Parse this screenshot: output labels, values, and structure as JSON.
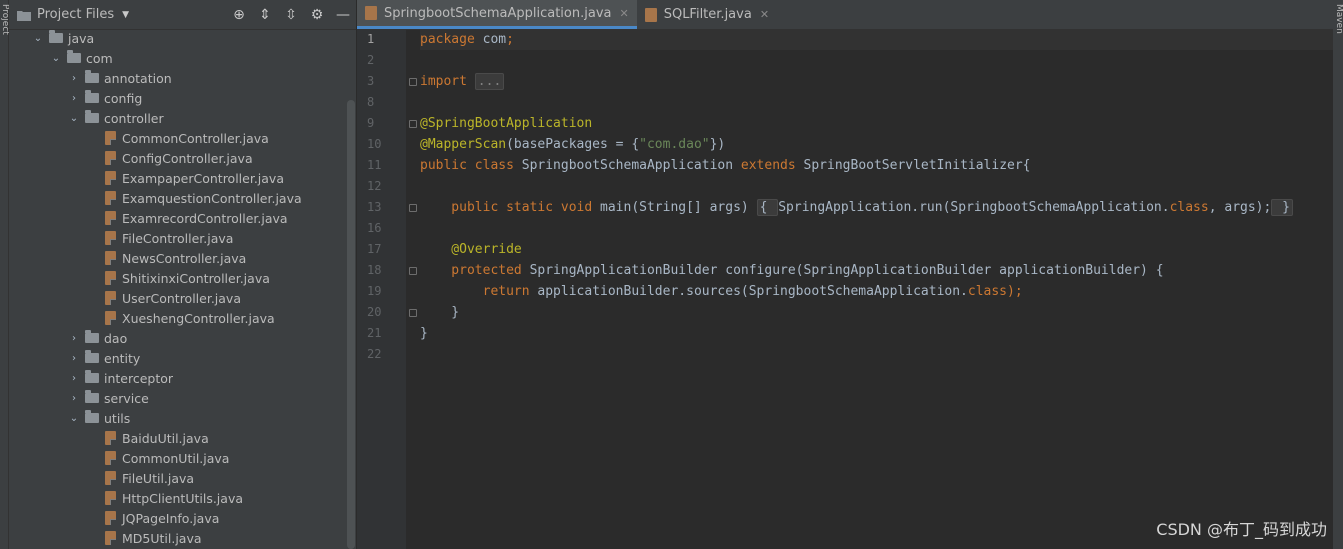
{
  "left_strip": {
    "label": "Project"
  },
  "right_strip": {
    "label": "Maven"
  },
  "project_panel": {
    "title": "Project Files"
  },
  "tree": [
    {
      "depth": 2,
      "type": "folder",
      "expanded": true,
      "label": "java"
    },
    {
      "depth": 3,
      "type": "folder",
      "expanded": true,
      "label": "com"
    },
    {
      "depth": 4,
      "type": "folder",
      "expanded": false,
      "label": "annotation"
    },
    {
      "depth": 4,
      "type": "folder",
      "expanded": false,
      "label": "config"
    },
    {
      "depth": 4,
      "type": "folder",
      "expanded": true,
      "label": "controller"
    },
    {
      "depth": 5,
      "type": "file",
      "label": "CommonController.java"
    },
    {
      "depth": 5,
      "type": "file",
      "label": "ConfigController.java"
    },
    {
      "depth": 5,
      "type": "file",
      "label": "ExampaperController.java"
    },
    {
      "depth": 5,
      "type": "file",
      "label": "ExamquestionController.java"
    },
    {
      "depth": 5,
      "type": "file",
      "label": "ExamrecordController.java"
    },
    {
      "depth": 5,
      "type": "file",
      "label": "FileController.java"
    },
    {
      "depth": 5,
      "type": "file",
      "label": "NewsController.java"
    },
    {
      "depth": 5,
      "type": "file",
      "label": "ShitixinxiController.java"
    },
    {
      "depth": 5,
      "type": "file",
      "label": "UserController.java"
    },
    {
      "depth": 5,
      "type": "file",
      "label": "XueshengController.java"
    },
    {
      "depth": 4,
      "type": "folder",
      "expanded": false,
      "label": "dao"
    },
    {
      "depth": 4,
      "type": "folder",
      "expanded": false,
      "label": "entity"
    },
    {
      "depth": 4,
      "type": "folder",
      "expanded": false,
      "label": "interceptor"
    },
    {
      "depth": 4,
      "type": "folder",
      "expanded": false,
      "label": "service"
    },
    {
      "depth": 4,
      "type": "folder",
      "expanded": true,
      "label": "utils"
    },
    {
      "depth": 5,
      "type": "file",
      "label": "BaiduUtil.java"
    },
    {
      "depth": 5,
      "type": "file",
      "label": "CommonUtil.java"
    },
    {
      "depth": 5,
      "type": "file",
      "label": "FileUtil.java"
    },
    {
      "depth": 5,
      "type": "file",
      "label": "HttpClientUtils.java"
    },
    {
      "depth": 5,
      "type": "file",
      "label": "JQPageInfo.java"
    },
    {
      "depth": 5,
      "type": "file",
      "label": "MD5Util.java"
    }
  ],
  "tabs": [
    {
      "label": "SpringbootSchemaApplication.java",
      "active": true
    },
    {
      "label": "SQLFilter.java",
      "active": false
    }
  ],
  "code": {
    "line_numbers": [
      "1",
      "2",
      "3",
      "8",
      "9",
      "10",
      "11",
      "12",
      "13",
      "16",
      "17",
      "18",
      "19",
      "20",
      "21",
      "22"
    ],
    "current_line_index": 0,
    "lines": [
      [
        {
          "t": "package ",
          "c": "kw"
        },
        {
          "t": "com",
          "c": ""
        },
        {
          "t": ";",
          "c": "kw"
        }
      ],
      [],
      [
        {
          "t": "import ",
          "c": "kw"
        },
        {
          "t": "...",
          "c": "box gray"
        }
      ],
      [],
      [
        {
          "t": "@SpringBootApplication",
          "c": "an"
        }
      ],
      [
        {
          "t": "@MapperScan",
          "c": "an"
        },
        {
          "t": "(basePackages = {",
          "c": ""
        },
        {
          "t": "\"com.dao\"",
          "c": "st"
        },
        {
          "t": "})",
          "c": ""
        }
      ],
      [
        {
          "t": "public class ",
          "c": "kw"
        },
        {
          "t": "SpringbootSchemaApplication ",
          "c": ""
        },
        {
          "t": "extends ",
          "c": "kw"
        },
        {
          "t": "SpringBootServletInitializer{",
          "c": ""
        }
      ],
      [],
      [
        {
          "t": "    public static void ",
          "c": "kw"
        },
        {
          "t": "main(String[] args) ",
          "c": ""
        },
        {
          "t": "{ ",
          "c": "box"
        },
        {
          "t": "SpringApplication.",
          "c": ""
        },
        {
          "t": "run",
          "c": ""
        },
        {
          "t": "(SpringbootSchemaApplication.",
          "c": ""
        },
        {
          "t": "class",
          "c": "kw"
        },
        {
          "t": ", args);",
          "c": ""
        },
        {
          "t": " }",
          "c": "box"
        }
      ],
      [],
      [
        {
          "t": "    @Override",
          "c": "an"
        }
      ],
      [
        {
          "t": "    protected ",
          "c": "kw"
        },
        {
          "t": "SpringApplicationBuilder configure(SpringApplicationBuilder applicationBuilder) {",
          "c": ""
        }
      ],
      [
        {
          "t": "        return ",
          "c": "kw"
        },
        {
          "t": "applicationBuilder.sources(SpringbootSchemaApplication.",
          "c": ""
        },
        {
          "t": "class",
          "c": "kw"
        },
        {
          "t": ");",
          "c": "kw"
        }
      ],
      [
        {
          "t": "    }",
          "c": ""
        }
      ],
      [
        {
          "t": "}",
          "c": ""
        }
      ],
      []
    ]
  },
  "watermark": "CSDN @布丁_码到成功"
}
